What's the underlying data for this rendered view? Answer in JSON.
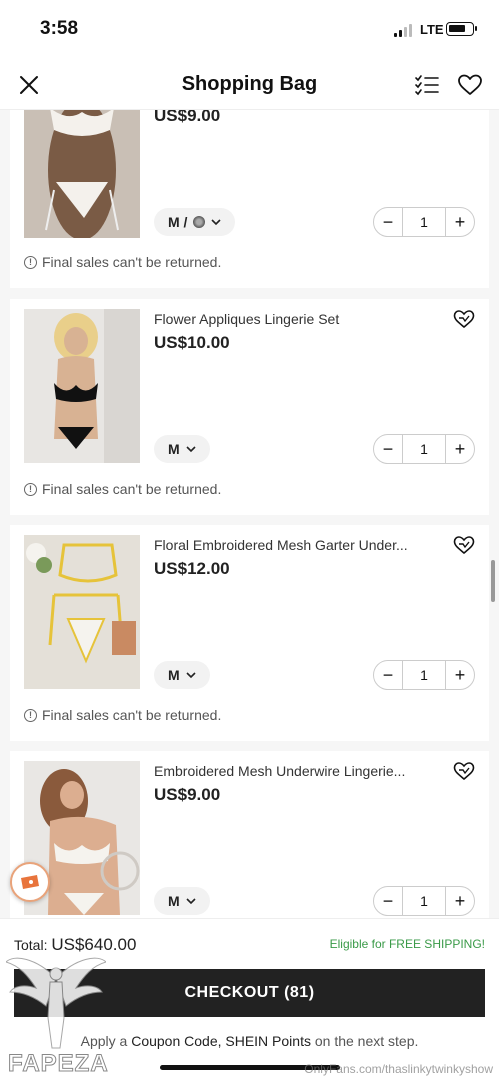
{
  "status_bar": {
    "time": "3:58",
    "network": "LTE"
  },
  "header": {
    "title": "Shopping Bag",
    "close_icon": "close-icon",
    "list_icon": "checklist-icon",
    "wishlist_icon": "heart-icon"
  },
  "items": [
    {
      "name": "",
      "price": "US$9.00",
      "size": "M / ",
      "qty": "1",
      "notice": "Final sales can't be returned."
    },
    {
      "name": "Flower Appliques Lingerie Set",
      "price": "US$10.00",
      "size": "M",
      "qty": "1",
      "notice": "Final sales can't be returned."
    },
    {
      "name": "Floral Embroidered Mesh Garter Under...",
      "price": "US$12.00",
      "size": "M",
      "qty": "1",
      "notice": "Final sales can't be returned."
    },
    {
      "name": "Embroidered Mesh Underwire Lingerie...",
      "price": "US$9.00",
      "size": "M",
      "qty": "1"
    }
  ],
  "stepper": {
    "minus": "−",
    "plus": "+"
  },
  "footer": {
    "total_label": "Total:",
    "total_value": "US$640.00",
    "free_shipping": "Eligible for FREE SHIPPING!",
    "checkout_label": "CHECKOUT (81)",
    "coupon_pre": "Apply a",
    "coupon_code": "Coupon Code, SHEIN Points",
    "coupon_post": "on the next step."
  },
  "watermarks": {
    "left": "FAPEZA",
    "right": "OnlyFans.com/thaslinkytwinkyshow"
  },
  "colors": {
    "accent_dark": "#222222",
    "free_ship_green": "#3a9a48",
    "coupon_fab_border": "#e9a37a"
  }
}
